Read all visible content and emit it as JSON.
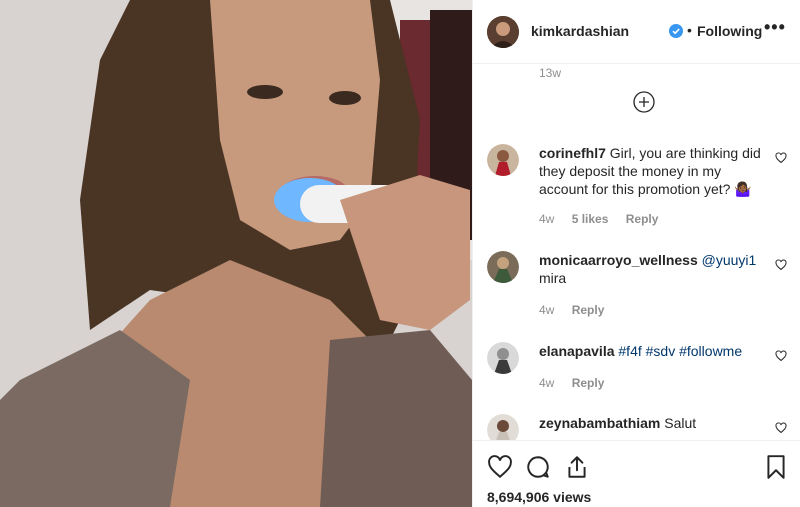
{
  "header": {
    "username": "kimkardashian",
    "separator": "•",
    "follow_status": "Following",
    "more_label": "•••"
  },
  "comments_area": {
    "previous_time": "13w",
    "items": [
      {
        "username": "corinefhl7",
        "text": "Girl, you are thinking did they deposit the money in my account for this promotion yet? 🤷🏾‍♀️",
        "time": "4w",
        "likes": "5 likes",
        "reply": "Reply"
      },
      {
        "username": "monicaarroyo_wellness",
        "mention": "@yuuyi1",
        "text": "mira",
        "time": "4w",
        "reply": "Reply"
      },
      {
        "username": "elanapavila",
        "tags": "#f4f #sdv #followme",
        "time": "4w",
        "reply": "Reply"
      },
      {
        "username": "zeynabambathiam",
        "text": "Salut"
      }
    ]
  },
  "footer": {
    "views": "8,694,906 views"
  },
  "colors": {
    "link": "#00376b",
    "meta": "#8e8e8e",
    "verified": "#3897f0"
  }
}
